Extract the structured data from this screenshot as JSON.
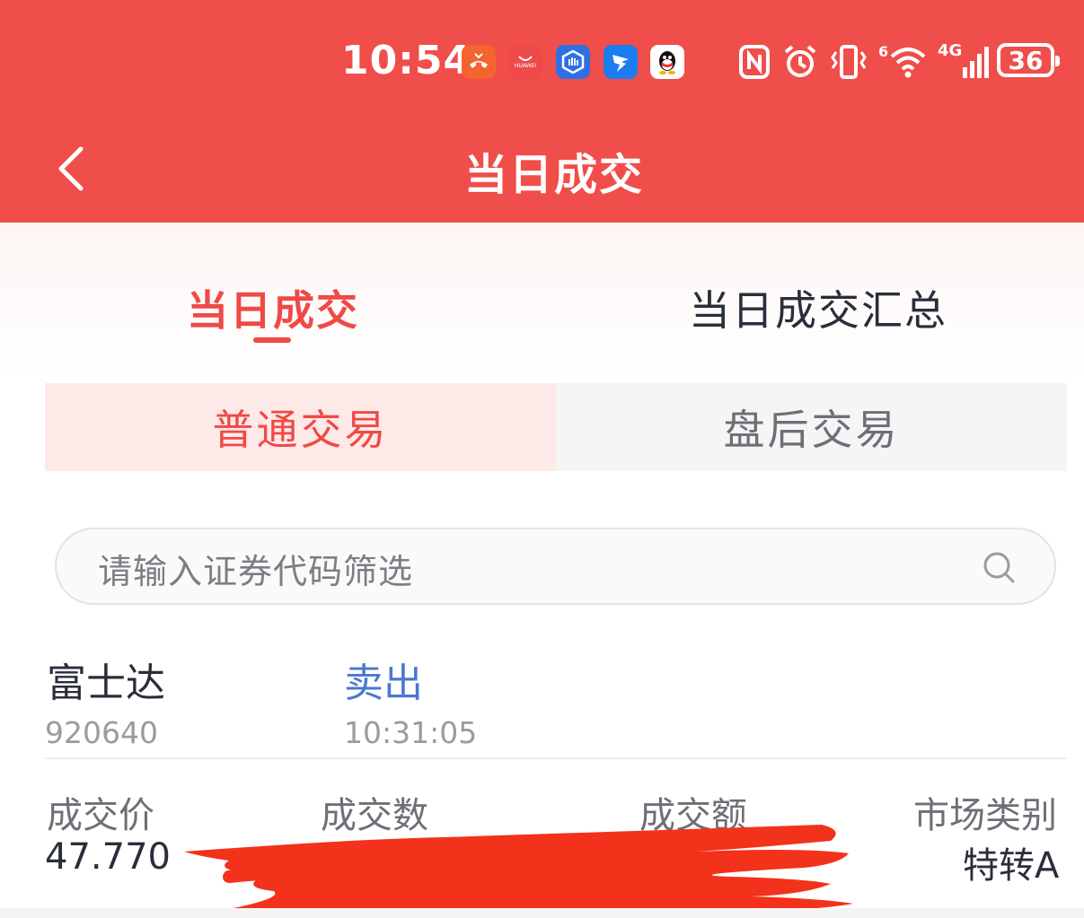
{
  "status_bar": {
    "time": "10:54",
    "huawei_label": "HUAWEI",
    "network_label": "4G",
    "wifi_label": "6",
    "battery": "36"
  },
  "header": {
    "title": "当日成交"
  },
  "tabs": [
    {
      "label": "当日成交",
      "active": true
    },
    {
      "label": "当日成交汇总",
      "active": false
    }
  ],
  "segments": [
    {
      "label": "普通交易",
      "active": true
    },
    {
      "label": "盘后交易",
      "active": false
    }
  ],
  "search": {
    "placeholder": "请输入证券代码筛选"
  },
  "trade": {
    "name": "富士达",
    "code": "920640",
    "direction": "卖出",
    "time": "10:31:05",
    "labels": {
      "price": "成交价",
      "quantity": "成交数",
      "amount": "成交额",
      "market": "市场类别"
    },
    "price": "47.770",
    "market": "特转A"
  },
  "colors": {
    "header_bg": "#f04e4a",
    "accent_red": "#ef4a46",
    "sell_blue": "#4a78d1",
    "redaction": "#f2321a"
  },
  "icons": [
    "back-icon",
    "search-icon",
    "nfc-icon",
    "alarm-icon",
    "vibrate-icon",
    "wifi-icon",
    "signal-icon",
    "battery-icon"
  ]
}
